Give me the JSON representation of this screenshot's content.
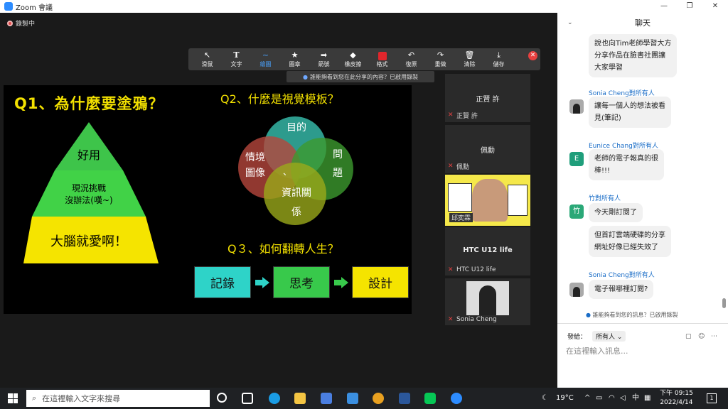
{
  "window": {
    "title": "Zoom 會議",
    "controls": [
      "—",
      "❐",
      "✕"
    ]
  },
  "recording": {
    "label": "錄製中"
  },
  "toolbar": {
    "items": [
      {
        "icon": "↖",
        "label": "滑鼠"
      },
      {
        "icon": "T",
        "label": "文字"
      },
      {
        "icon": "~",
        "label": "繪圖"
      },
      {
        "icon": "★",
        "label": "圖章"
      },
      {
        "icon": "➡",
        "label": "箭號"
      },
      {
        "icon": "◆",
        "label": "橡皮擦"
      },
      {
        "icon": "",
        "label": "格式"
      },
      {
        "icon": "↶",
        "label": "復原"
      },
      {
        "icon": "↷",
        "label": "重做"
      },
      {
        "icon": "🗑",
        "label": "清除"
      },
      {
        "icon": "⤓",
        "label": "儲存"
      }
    ],
    "close": "✕"
  },
  "share_notice": "誰能夠看到您在此分享的內容？已啟用錄製",
  "slide": {
    "q1": "Q1、為什麼要塗鴉？",
    "q2": "Q2、什麼是視覺模板？",
    "q3": "Q３、如何翻轉人生？",
    "pyramid": [
      "好用",
      "現況挑戰",
      "沒辦法(嘆~)",
      "大腦就愛啊！"
    ],
    "venn": {
      "top": "目的",
      "left1": "情境",
      "left2": "圖像",
      "right1": "問",
      "right2": "題",
      "bottom1": "資訊關",
      "bottom2": "係",
      "center": "、"
    },
    "tiles": [
      "記錄",
      "思考",
      "設計"
    ]
  },
  "participants": [
    {
      "name_center": "正賢 許",
      "label": "正賢 許"
    },
    {
      "name_center": "佩勳",
      "label": "佩勳"
    },
    {
      "name_center": "",
      "label": "邱奕霖"
    },
    {
      "name_center": "HTC U12 life",
      "label": "HTC U12 life"
    },
    {
      "name_center": "",
      "label": "Sonia Cheng"
    }
  ],
  "chat": {
    "title": "聊天",
    "messages": [
      {
        "sender": "",
        "lines": [
          "說也向Tim老師學習大方",
          "分享作品在臉書社團讓",
          "大家學習"
        ]
      },
      {
        "sender": "Sonia Cheng",
        "to": "對所有人",
        "lines": [
          "讓每一個人的想法被看",
          "見(筆記)"
        ]
      },
      {
        "sender": "Eunice Chang",
        "to": "對所有人",
        "avatar": "E",
        "lines": [
          "老師的電子報真的很",
          "棒!!!"
        ]
      },
      {
        "sender": "竹",
        "to": "對所有人",
        "avatar": "竹",
        "lines": [
          "今天剛訂閱了"
        ]
      },
      {
        "sender": "",
        "lines": [
          "但首訂雲端硬碟的分享",
          "網址好像已經失效了"
        ]
      },
      {
        "sender": "Sonia Cheng",
        "to": "對所有人",
        "lines": [
          "電子報哪裡訂閱?"
        ]
      }
    ],
    "visibility_note": "誰能夠看到您的訊息？已啟用錄製",
    "send_to_label": "發給：",
    "send_to_value": "所有人",
    "input_placeholder": "在這裡輸入訊息..."
  },
  "taskbar": {
    "search_placeholder": "在這裡輸入文字來搜尋",
    "weather": "19°C",
    "ime": "中",
    "time": "下午 09:15",
    "date": "2022/4/14",
    "notifications": "1"
  },
  "colors": {
    "accent": "#f2e000",
    "chat_link": "#1a6dc7",
    "teal": "#2ed3c8",
    "green": "#38c94b",
    "yellow_tile": "#f5e400"
  }
}
